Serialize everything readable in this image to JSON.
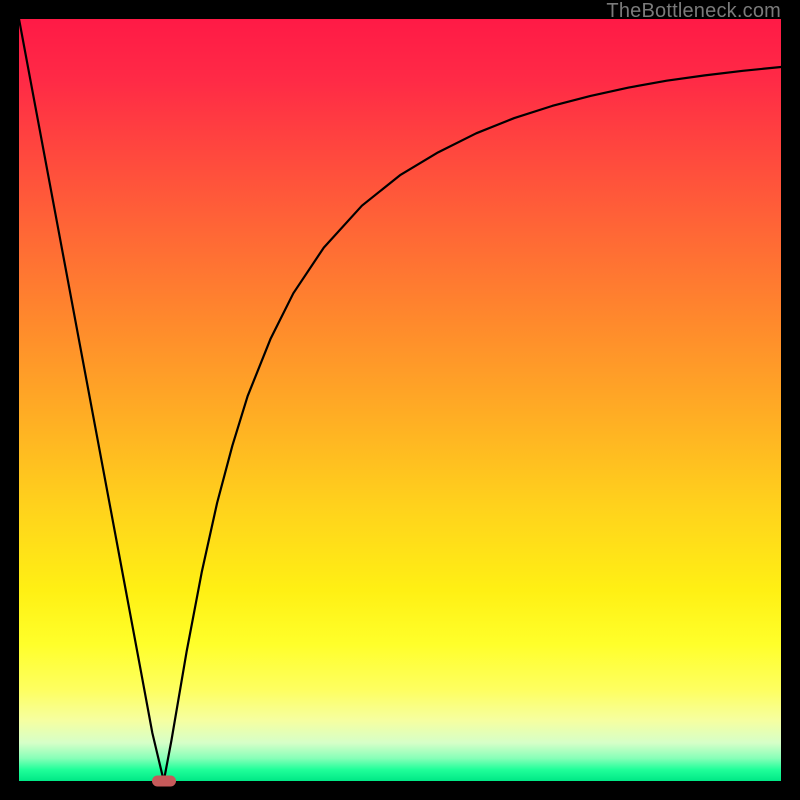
{
  "attribution": "TheBottleneck.com",
  "colors": {
    "frame": "#000000",
    "curve": "#000000",
    "marker": "#c55a5a",
    "gradient_top": "#ff1a46",
    "gradient_mid": "#ffff2a",
    "gradient_bottom": "#00e886"
  },
  "chart_data": {
    "type": "line",
    "title": "",
    "xlabel": "",
    "ylabel": "",
    "xlim": [
      0,
      100
    ],
    "ylim": [
      0,
      100
    ],
    "x": [
      0,
      2,
      4,
      6,
      8,
      10,
      12,
      14,
      16,
      17.5,
      19,
      20,
      22,
      24,
      26,
      28,
      30,
      33,
      36,
      40,
      45,
      50,
      55,
      60,
      65,
      70,
      75,
      80,
      85,
      90,
      95,
      100
    ],
    "y": [
      100,
      89.3,
      78.6,
      67.9,
      57.2,
      46.5,
      35.8,
      25.1,
      14.4,
      6.3,
      0,
      5.3,
      17.0,
      27.5,
      36.5,
      44.0,
      50.5,
      58.0,
      64.0,
      70.0,
      75.5,
      79.5,
      82.5,
      85.0,
      87.0,
      88.6,
      89.9,
      91.0,
      91.9,
      92.6,
      93.2,
      93.7
    ],
    "marker": {
      "x": 19,
      "y": 0
    },
    "grid": false,
    "legend": false
  }
}
